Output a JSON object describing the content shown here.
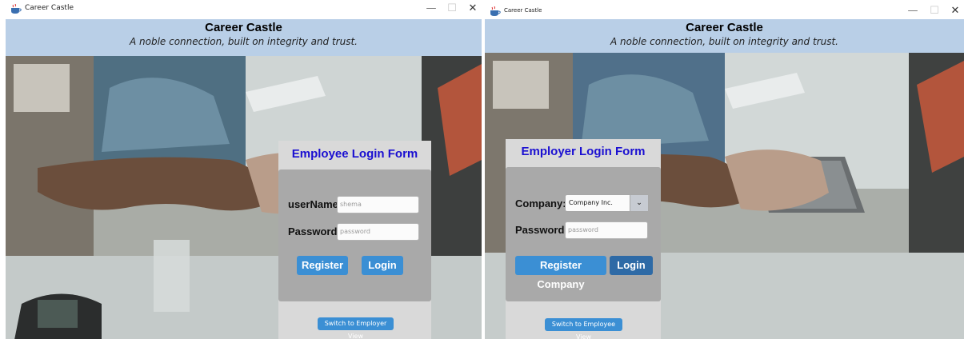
{
  "left": {
    "window_title": "Career Castle",
    "header_title": "Career Castle",
    "header_subtitle": "A noble connection, built on integrity and trust.",
    "form_title": "Employee Login Form",
    "username_label": "userName:",
    "username_value": "shema",
    "password_label": "Password:",
    "password_placeholder": "password",
    "register_label": "Register",
    "login_label": "Login",
    "switch_label": "Switch to Employer View"
  },
  "right": {
    "window_title": "Career Castle",
    "header_title": "Career Castle",
    "header_subtitle": "A noble connection, built on integrity and trust.",
    "form_title": "Employer Login Form",
    "company_label": "Company:",
    "company_value": "Company Inc.",
    "password_label": "Password:",
    "password_placeholder": "password",
    "register_label": "Register Company",
    "login_label": "Login",
    "switch_label": "Switch to Employee View"
  },
  "window_controls": {
    "minimize": "—",
    "maximize": "☐",
    "close": "✕"
  },
  "icons": {
    "app": "coffee-cup-icon",
    "dropdown": "chevron-down-icon"
  },
  "colors": {
    "header": "#b9cfe7",
    "title_text": "#1a0fd1",
    "button": "#3b8fd4",
    "button_active": "#2e6aa6"
  }
}
